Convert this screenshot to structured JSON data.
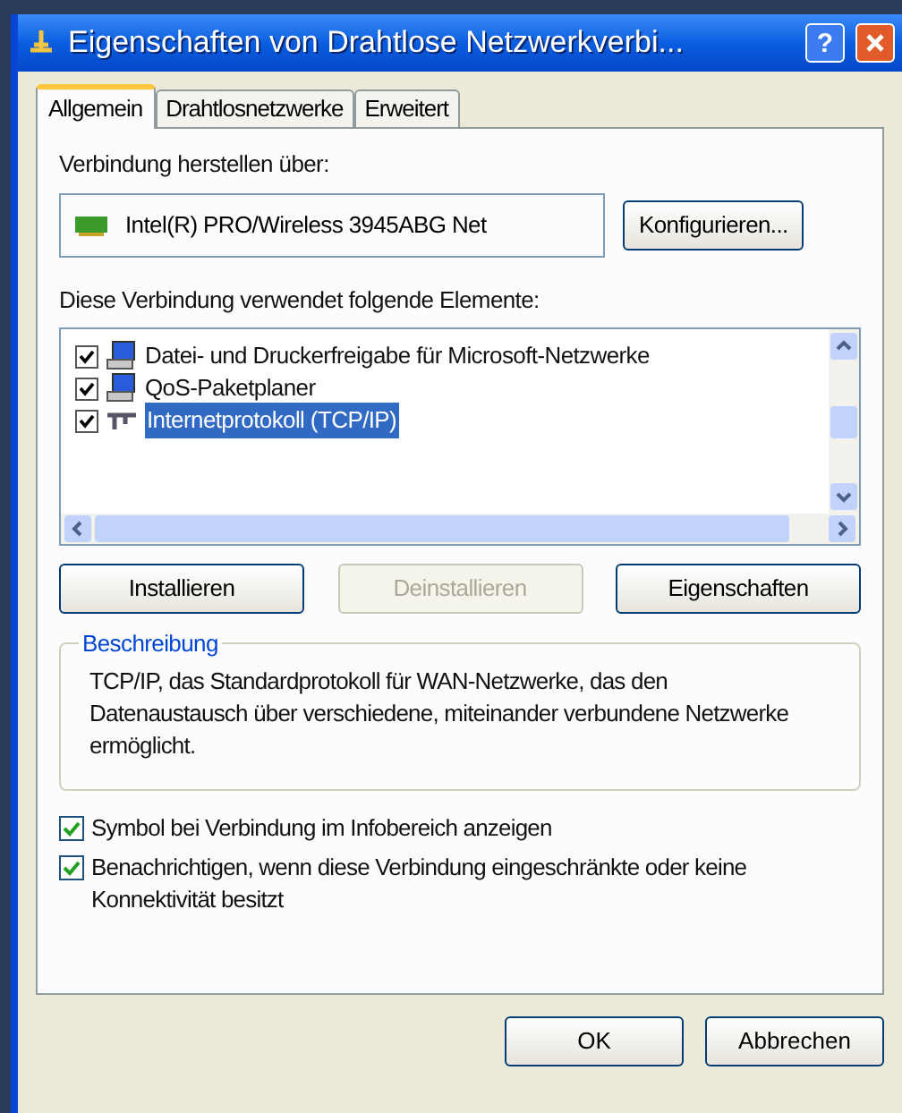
{
  "window": {
    "title": "Eigenschaften von Drahtlose Netzwerkverbi...",
    "help_button": "?"
  },
  "tabs": [
    {
      "label": "Allgemein",
      "selected": true
    },
    {
      "label": "Drahtlosnetzwerke",
      "selected": false
    },
    {
      "label": "Erweitert",
      "selected": false
    }
  ],
  "connect_via": {
    "label": "Verbindung herstellen über:",
    "adapter": "Intel(R) PRO/Wireless 3945ABG Net",
    "button": "Konfigurieren..."
  },
  "components": {
    "label": "Diese Verbindung verwendet folgende Elemente:",
    "items": [
      {
        "name": "Datei- und Druckerfreigabe für Microsoft-Netzwerke",
        "kind": "computer",
        "checked": true,
        "selected": false
      },
      {
        "name": "QoS-Paketplaner",
        "kind": "computer",
        "checked": true,
        "selected": false
      },
      {
        "name": "Internetprotokoll (TCP/IP)",
        "kind": "network",
        "checked": true,
        "selected": true
      }
    ]
  },
  "component_buttons": [
    {
      "label": "Installieren",
      "disabled": false
    },
    {
      "label": "Deinstallieren",
      "disabled": true
    },
    {
      "label": "Eigenschaften",
      "disabled": false
    }
  ],
  "description": {
    "title": "Beschreibung",
    "text": "TCP/IP, das Standardprotokoll für WAN-Netzwerke, das den Datenaustausch über verschiedene, miteinander verbundene Netzwerke ermöglicht."
  },
  "options": [
    {
      "label": "Symbol bei Verbindung im Infobereich anzeigen",
      "checked": true
    },
    {
      "label": "Benachrichtigen, wenn diese Verbindung eingeschränkte oder keine Konnektivität besitzt",
      "checked": true
    }
  ],
  "buttons": [
    {
      "label": "OK"
    },
    {
      "label": "Abbrechen"
    }
  ]
}
